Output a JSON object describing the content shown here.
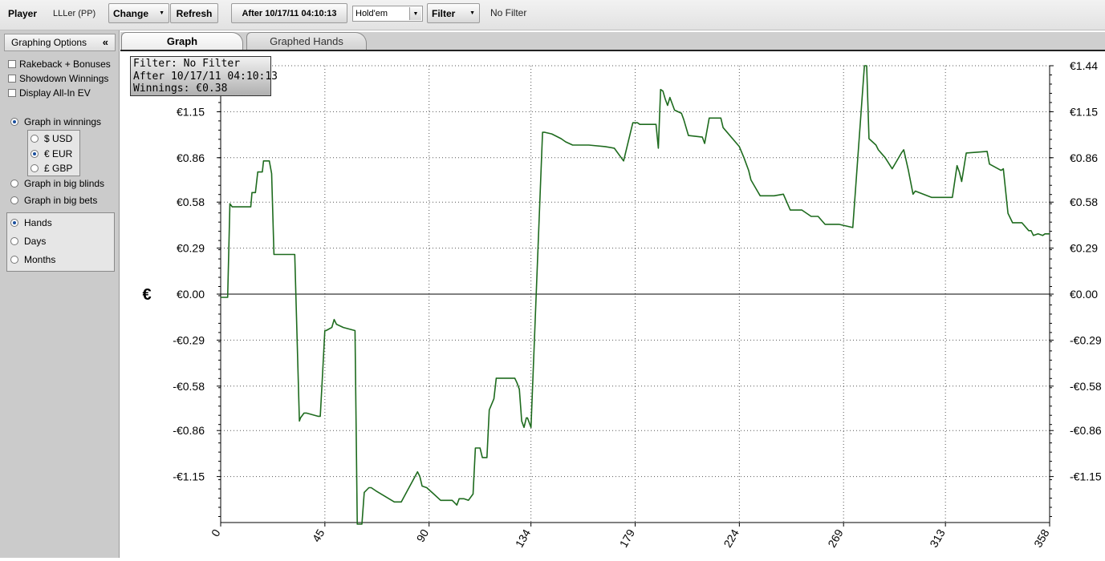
{
  "toolbar": {
    "player_label": "Player",
    "player_name": "LLLer (PP)",
    "change_label": "Change",
    "refresh_label": "Refresh",
    "date_filter_label": "After 10/17/11 04:10:13",
    "game_select_value": "Hold'em",
    "filter_label": "Filter",
    "filter_status": "No Filter"
  },
  "sidebar": {
    "header": "Graphing Options",
    "collapse_glyph": "«",
    "checkboxes": [
      {
        "label": "Rakeback + Bonuses",
        "checked": false
      },
      {
        "label": "Showdown Winnings",
        "checked": false
      },
      {
        "label": "Display All-In EV",
        "checked": false
      }
    ],
    "graph_in_winnings": "Graph in winnings",
    "currencies": [
      {
        "label": "$ USD",
        "selected": false
      },
      {
        "label": "€ EUR",
        "selected": true
      },
      {
        "label": "£ GBP",
        "selected": false
      }
    ],
    "graph_in_big_blinds": "Graph in big blinds",
    "graph_in_big_bets": "Graph in big bets",
    "x_axis_modes": [
      {
        "label": "Hands",
        "selected": true
      },
      {
        "label": "Days",
        "selected": false
      },
      {
        "label": "Months",
        "selected": false
      }
    ]
  },
  "tabs": [
    {
      "label": "Graph",
      "active": true
    },
    {
      "label": "Graphed Hands",
      "active": false
    }
  ],
  "tooltip": {
    "line1": "Filter: No Filter",
    "line2": "After 10/17/11 04:10:13",
    "line3": "Winnings: €0.38"
  },
  "colors": {
    "line": "#1e6b1e",
    "grid": "#555555"
  },
  "chart_data": {
    "type": "line",
    "ylabel": "€",
    "xlim": [
      0,
      358
    ],
    "ylim": [
      -1.44,
      1.44
    ],
    "x_ticks": [
      0,
      45,
      90,
      134,
      179,
      224,
      269,
      313,
      358
    ],
    "x_tick_labels": [
      "0",
      "45",
      "90",
      "134",
      "179",
      "224",
      "269",
      "313",
      "358"
    ],
    "y_ticks": [
      1.44,
      1.15,
      0.86,
      0.58,
      0.29,
      0.0,
      -0.29,
      -0.58,
      -0.86,
      -1.15
    ],
    "y_tick_labels": [
      "€1.44",
      "€1.15",
      "€0.86",
      "€0.58",
      "€0.29",
      "€0.00",
      "-€0.29",
      "-€0.58",
      "-€0.86",
      "-€1.15"
    ],
    "grid": true,
    "series": [
      {
        "x": [
          0,
          3,
          4,
          5,
          13,
          13.5,
          15,
          16,
          18,
          18.5,
          21,
          22,
          23,
          23.5,
          32,
          34,
          34.5,
          36,
          37,
          42,
          43,
          44,
          45,
          45.5,
          48,
          49,
          50,
          53,
          58,
          59,
          61,
          62,
          64,
          65,
          67,
          75,
          78,
          85,
          86,
          87,
          89,
          92,
          95,
          100,
          102,
          103,
          105,
          107,
          109,
          110,
          112,
          113,
          115,
          116,
          118,
          119,
          127,
          128,
          129,
          130,
          131,
          132,
          132.5,
          134,
          139,
          140,
          143,
          147,
          149,
          152,
          159,
          166,
          170,
          171,
          174,
          178,
          180,
          181,
          188,
          189,
          190,
          191,
          192,
          193,
          194,
          196,
          199,
          200,
          202,
          208,
          209,
          211,
          212,
          215,
          216,
          217,
          224,
          226,
          228,
          229,
          231,
          233,
          234,
          235,
          239,
          243,
          246,
          247,
          251,
          255,
          256,
          258,
          261,
          262,
          264,
          267,
          273,
          278,
          279,
          280,
          283,
          284,
          287,
          290,
          294,
          295,
          297,
          299,
          300,
          307,
          308,
          311,
          312,
          314,
          316,
          318,
          319,
          320,
          322,
          331,
          332,
          337,
          338,
          340,
          342,
          345,
          346,
          349,
          350,
          351,
          353,
          355,
          356,
          358
        ],
        "y": [
          -0.02,
          -0.02,
          0.57,
          0.55,
          0.55,
          0.64,
          0.64,
          0.77,
          0.77,
          0.84,
          0.84,
          0.76,
          0.25,
          0.25,
          0.25,
          -0.8,
          -0.78,
          -0.75,
          -0.75,
          -0.77,
          -0.77,
          -0.5,
          -0.23,
          -0.23,
          -0.21,
          -0.16,
          -0.19,
          -0.21,
          -0.23,
          -1.45,
          -1.45,
          -1.25,
          -1.22,
          -1.22,
          -1.24,
          -1.31,
          -1.31,
          -1.12,
          -1.15,
          -1.21,
          -1.22,
          -1.26,
          -1.3,
          -1.3,
          -1.33,
          -1.29,
          -1.29,
          -1.3,
          -1.26,
          -0.97,
          -0.97,
          -1.03,
          -1.03,
          -0.73,
          -0.66,
          -0.53,
          -0.53,
          -0.56,
          -0.6,
          -0.8,
          -0.84,
          -0.78,
          -0.78,
          -0.84,
          1.02,
          1.02,
          1.01,
          0.98,
          0.96,
          0.94,
          0.94,
          0.93,
          0.92,
          0.9,
          0.84,
          1.08,
          1.08,
          1.07,
          1.07,
          0.92,
          1.29,
          1.28,
          1.23,
          1.19,
          1.24,
          1.16,
          1.14,
          1.1,
          1.0,
          0.99,
          0.95,
          1.11,
          1.11,
          1.11,
          1.11,
          1.05,
          0.93,
          0.86,
          0.78,
          0.72,
          0.67,
          0.62,
          0.62,
          0.62,
          0.62,
          0.63,
          0.53,
          0.53,
          0.53,
          0.49,
          0.49,
          0.49,
          0.44,
          0.44,
          0.44,
          0.44,
          0.42,
          1.44,
          1.44,
          0.98,
          0.94,
          0.91,
          0.86,
          0.79,
          0.89,
          0.91,
          0.78,
          0.63,
          0.65,
          0.61,
          0.61,
          0.61,
          0.61,
          0.61,
          0.61,
          0.81,
          0.77,
          0.71,
          0.89,
          0.9,
          0.82,
          0.78,
          0.79,
          0.51,
          0.45,
          0.45,
          0.45,
          0.4,
          0.4,
          0.37,
          0.38,
          0.37,
          0.38,
          0.38
        ]
      }
    ]
  }
}
